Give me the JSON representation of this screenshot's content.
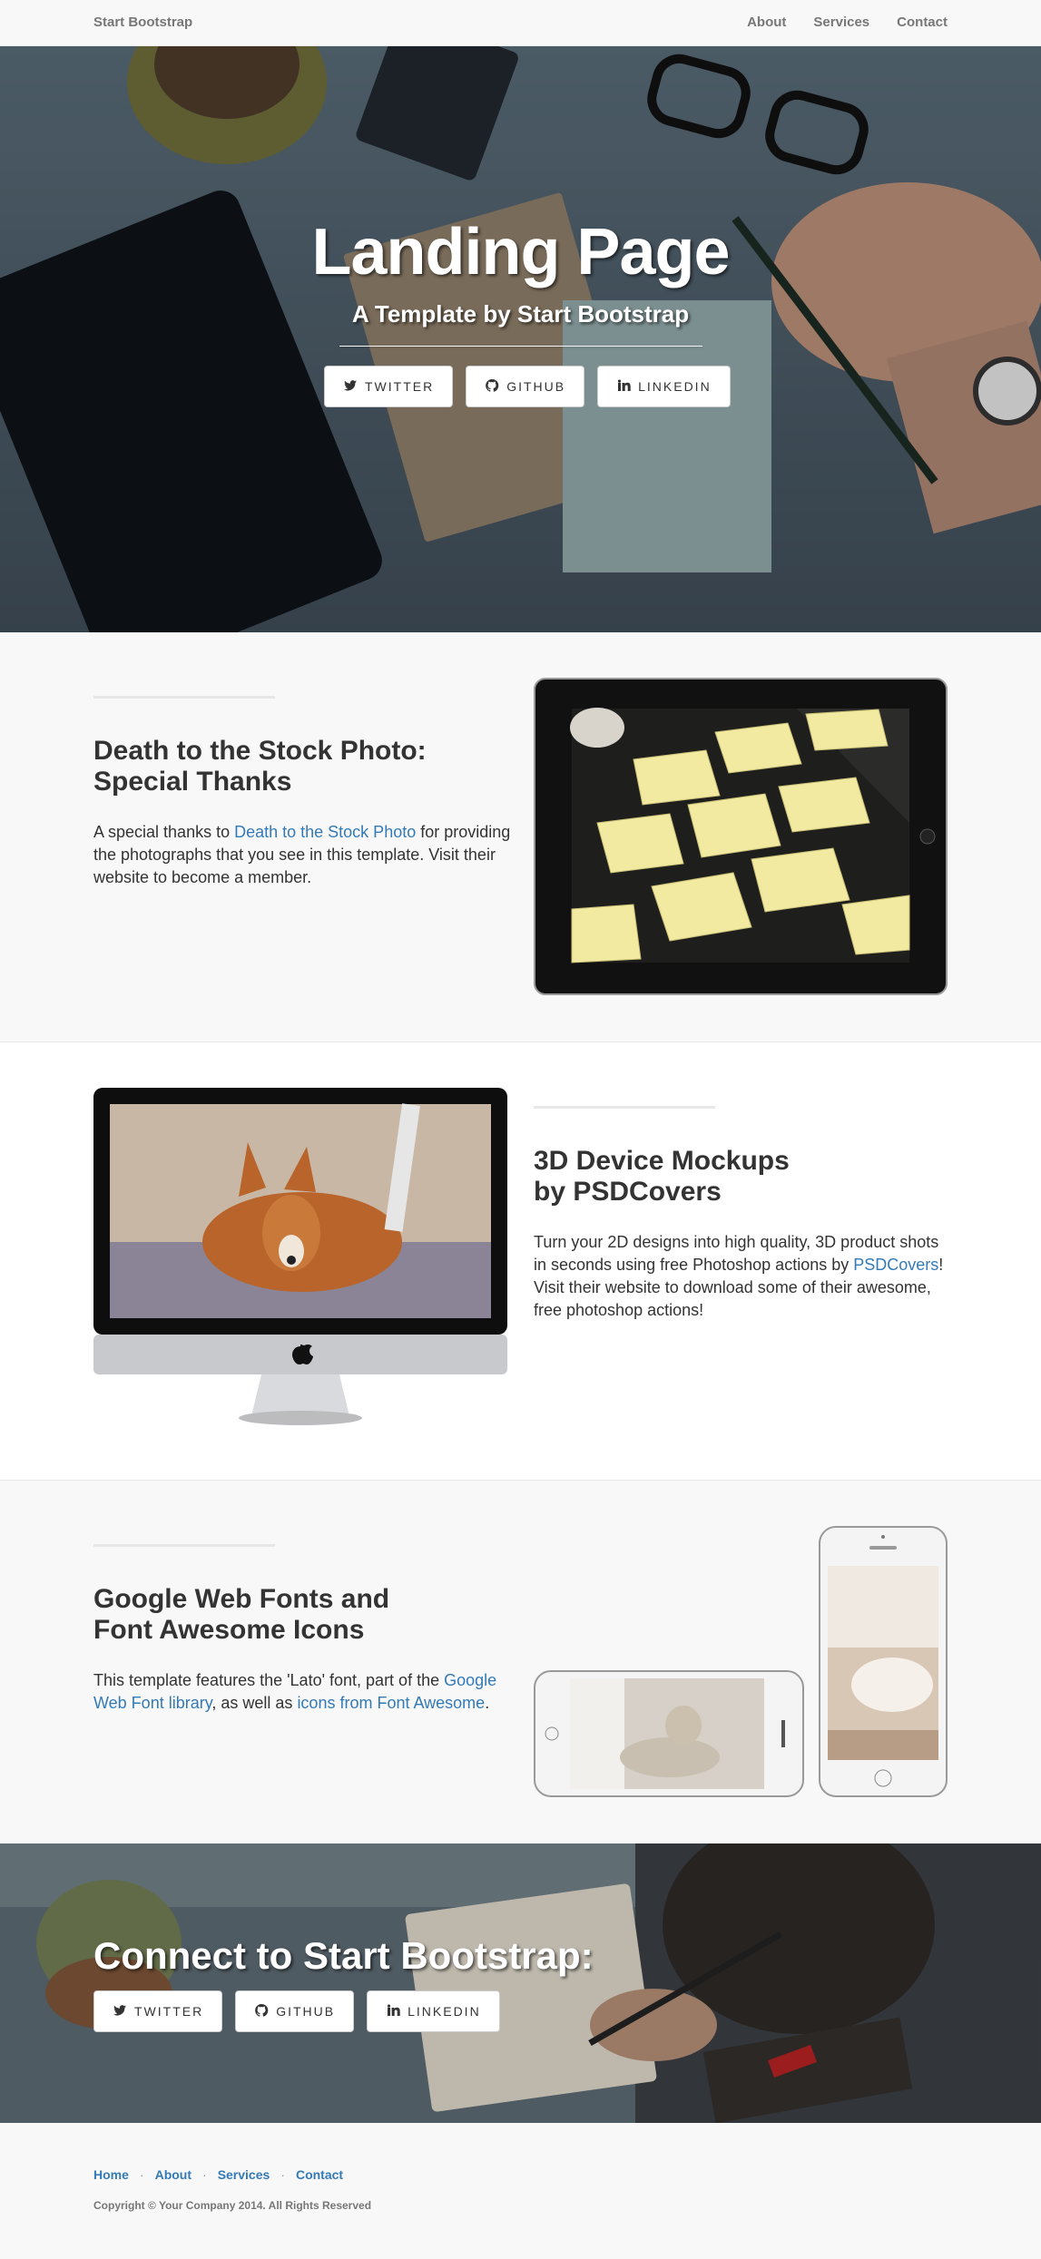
{
  "navbar": {
    "brand": "Start Bootstrap",
    "links": [
      "About",
      "Services",
      "Contact"
    ]
  },
  "hero": {
    "title": "Landing Page",
    "subtitle": "A Template by Start Bootstrap",
    "buttons": [
      {
        "label": "TWITTER",
        "icon": "twitter-icon"
      },
      {
        "label": "GITHUB",
        "icon": "github-icon"
      },
      {
        "label": "LINKEDIN",
        "icon": "linkedin-icon"
      }
    ]
  },
  "section_stock": {
    "heading_line1": "Death to the Stock Photo:",
    "heading_line2": "Special Thanks",
    "text_before": "A special thanks to ",
    "link": "Death to the Stock Photo",
    "text_after": " for providing the photographs that you see in this template. Visit their website to become a member.",
    "image": "ipad-mockup"
  },
  "section_mockups": {
    "heading_line1": "3D Device Mockups",
    "heading_line2": "by PSDCovers",
    "text_before": "Turn your 2D designs into high quality, 3D product shots in seconds using free Photoshop actions by ",
    "link": "PSDCovers",
    "text_after": "! Visit their website to download some of their awesome, free photoshop actions!",
    "image": "imac-mockup"
  },
  "section_fonts": {
    "heading_line1": "Google Web Fonts and",
    "heading_line2": "Font Awesome Icons",
    "text_before": "This template features the 'Lato' font, part of the ",
    "link1": "Google Web Font library",
    "text_middle": ", as well as ",
    "link2": "icons from Font Awesome",
    "text_after": ".",
    "image": "iphone-mockups"
  },
  "banner": {
    "title": "Connect to Start Bootstrap:",
    "buttons": [
      {
        "label": "TWITTER",
        "icon": "twitter-icon"
      },
      {
        "label": "GITHUB",
        "icon": "github-icon"
      },
      {
        "label": "LINKEDIN",
        "icon": "linkedin-icon"
      }
    ]
  },
  "footer": {
    "links": [
      "Home",
      "About",
      "Services",
      "Contact"
    ],
    "separator": "·",
    "copyright": "Copyright © Your Company 2014. All Rights Reserved"
  },
  "colors": {
    "link": "#337ab7",
    "text": "#333333",
    "muted": "#777777",
    "background": "#f8f8f8"
  }
}
